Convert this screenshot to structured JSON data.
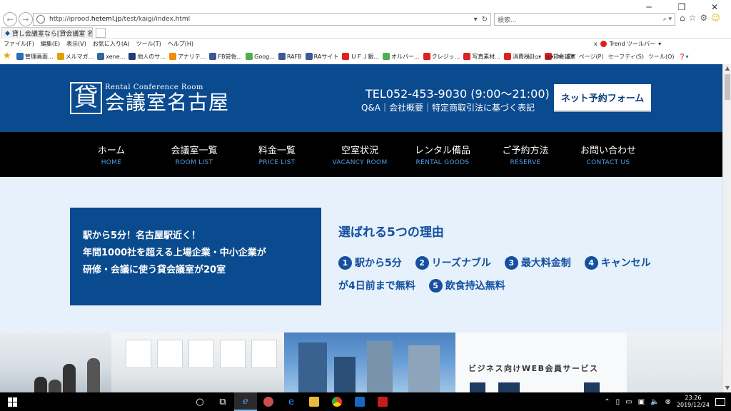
{
  "browser": {
    "url_prefix": "http://iprood.",
    "url_domain": "heteml.jp",
    "url_path": "/test/kaigi/index.html",
    "search_placeholder": "検索...",
    "window_controls": [
      "─",
      "❐",
      "✕"
    ],
    "tab_title": "貸し会議室なら[貸会議室 名...",
    "menu": [
      "ファイル(F)",
      "編集(E)",
      "表示(V)",
      "お気に入り(A)",
      "ツール(T)",
      "ヘルプ(H)"
    ],
    "trend_label": "Trend ツールバー",
    "favorites": [
      {
        "label": "管理画面...",
        "color": "#2a6db8"
      },
      {
        "label": "メルマガ...",
        "color": "#e0a000"
      },
      {
        "label": "xene...",
        "color": "#336699"
      },
      {
        "label": "他人のサ...",
        "color": "#1f3d7a"
      },
      {
        "label": "アナリテ...",
        "color": "#f28c00"
      },
      {
        "label": "FB尝佐...",
        "color": "#3b5998"
      },
      {
        "label": "Goog...",
        "color": "#4caf50"
      },
      {
        "label": "RAFB",
        "color": "#3b5998"
      },
      {
        "label": "RAサイト",
        "color": "#3b5998"
      },
      {
        "label": "ＵＦＪ銀...",
        "color": "#e02020"
      },
      {
        "label": "オルバー...",
        "color": "#4caf50"
      },
      {
        "label": "クレジッ...",
        "color": "#e02020"
      },
      {
        "label": "写真素材...",
        "color": "#e02020"
      },
      {
        "label": "消費税計...",
        "color": "#e02020"
      },
      {
        "label": "貸会議室",
        "color": "#e02020"
      }
    ],
    "ie_tools": [
      "ページ(P)",
      "セーフティ(S)",
      "ツール(O)"
    ]
  },
  "site": {
    "logo_kanji": "貸",
    "logo_sub": "Rental Conference Room",
    "logo_main": "会議室名古屋",
    "tel": "TEL052-453-9030 (9:00～21:00)",
    "header_links": "Q&A｜会社概要｜特定商取引法に基づく表記",
    "reserve_button": "ネット予約フォーム",
    "nav": [
      {
        "jp": "ホーム",
        "en": "HOME"
      },
      {
        "jp": "会議室一覧",
        "en": "ROOM LIST"
      },
      {
        "jp": "料金一覧",
        "en": "PRICE LIST"
      },
      {
        "jp": "空室状況",
        "en": "VACANCY ROOM"
      },
      {
        "jp": "レンタル備品",
        "en": "RENTAL GOODS"
      },
      {
        "jp": "ご予約方法",
        "en": "RESERVE"
      },
      {
        "jp": "お問い合わせ",
        "en": "CONTACT US"
      }
    ],
    "intro_lines": [
      "駅から5分！名古屋駅近く！",
      "年間1000社を超える上場企業・中小企業が",
      "研修・会議に使う貸会議室が20室"
    ],
    "reasons_title": "選ばれる5つの理由",
    "reasons": [
      {
        "num": "1",
        "text": "駅から5分"
      },
      {
        "num": "2",
        "text": "リーズナブル"
      },
      {
        "num": "3",
        "text": "最大料金制"
      },
      {
        "num": "4",
        "text": "キャンセルが4日前まで無料"
      },
      {
        "num": "5",
        "text": "飲食持込無料"
      }
    ],
    "banner_text": "ビジネス向けWEB会員サービス"
  },
  "taskbar": {
    "time": "23:26",
    "date": "2019/12/24"
  }
}
